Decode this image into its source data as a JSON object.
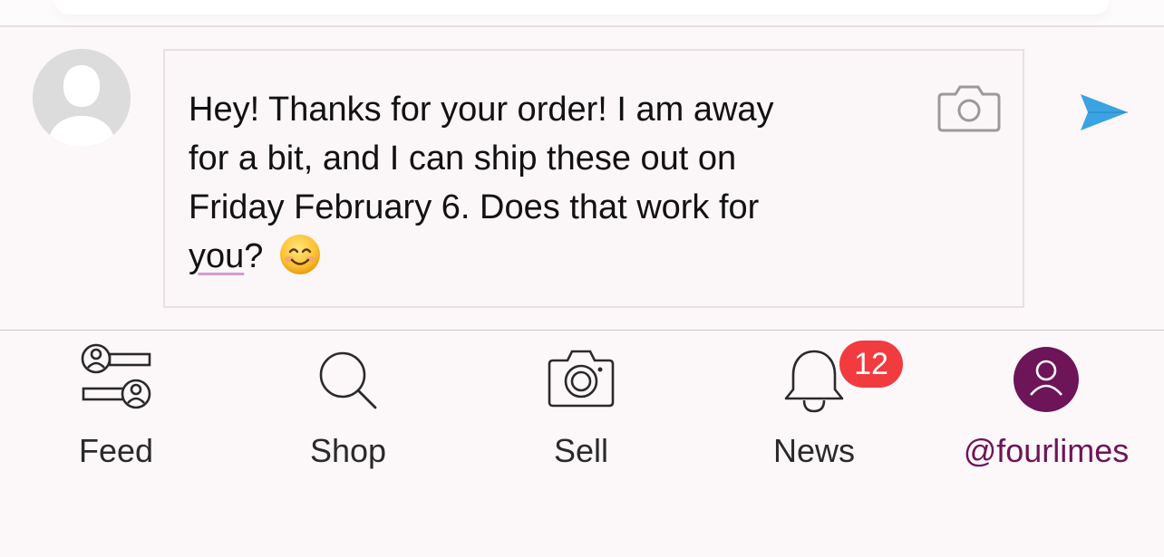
{
  "composer": {
    "message_lines": [
      "Hey! Thanks for your order! I am away",
      "for a bit, and I can ship these out on",
      "Friday February 6. Does that work for"
    ],
    "message_last_word": "you",
    "message_last_punct": "?",
    "emoji": "smiling-face-with-smiling-eyes",
    "camera_icon": "camera-icon",
    "send_icon": "send-icon",
    "accent_send": "#3aa3e3"
  },
  "tabbar": {
    "tabs": [
      {
        "id": "feed",
        "label": "Feed",
        "icon": "feed-icon"
      },
      {
        "id": "shop",
        "label": "Shop",
        "icon": "search-icon"
      },
      {
        "id": "sell",
        "label": "Sell",
        "icon": "camera-icon"
      },
      {
        "id": "news",
        "label": "News",
        "icon": "bell-icon",
        "badge": "12"
      },
      {
        "id": "profile",
        "label": "@fourlimes",
        "icon": "user-icon",
        "active": true
      }
    ],
    "active_color": "#6e1458",
    "badge_color": "#f23b3f"
  }
}
